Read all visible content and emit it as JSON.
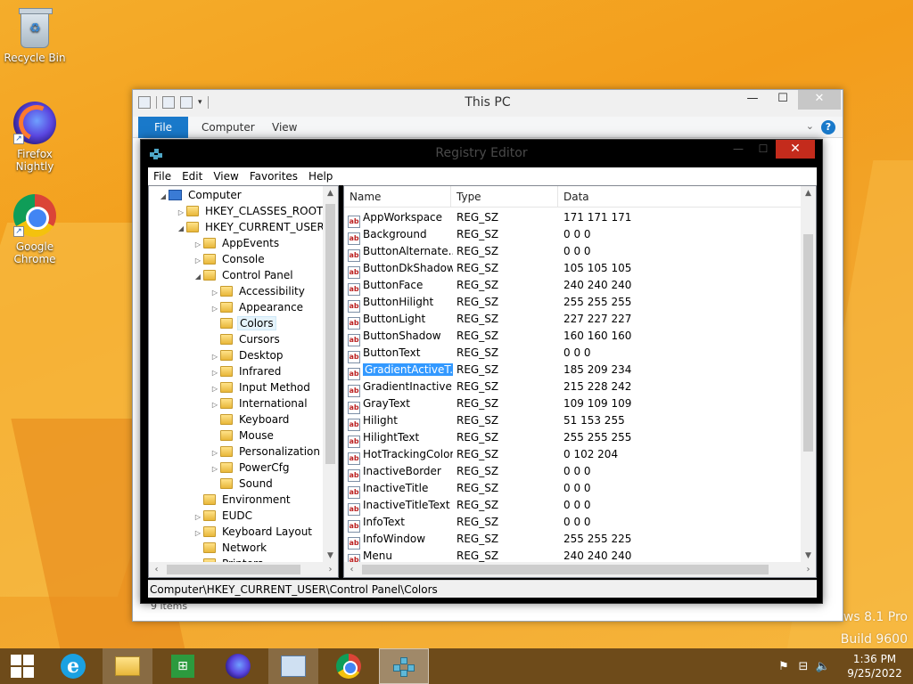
{
  "desktop": {
    "icons": [
      {
        "label": "Recycle Bin"
      },
      {
        "label": "Firefox Nightly"
      },
      {
        "label": "Google Chrome"
      }
    ],
    "watermark_line1": "ows 8.1 Pro",
    "watermark_line2": "Build 9600"
  },
  "explorer": {
    "title": "This PC",
    "tabs": [
      "File",
      "Computer",
      "View"
    ],
    "status": "9 items",
    "help": "?"
  },
  "regedit": {
    "title": "Registry Editor",
    "menu": [
      "File",
      "Edit",
      "View",
      "Favorites",
      "Help"
    ],
    "tree": [
      {
        "label": "Computer",
        "level": 0,
        "exp": "◢",
        "icon": "pc"
      },
      {
        "label": "HKEY_CLASSES_ROOT",
        "level": 1,
        "exp": "▷"
      },
      {
        "label": "HKEY_CURRENT_USER",
        "level": 1,
        "exp": "◢"
      },
      {
        "label": "AppEvents",
        "level": 2,
        "exp": "▷"
      },
      {
        "label": "Console",
        "level": 2,
        "exp": "▷"
      },
      {
        "label": "Control Panel",
        "level": 2,
        "exp": "◢"
      },
      {
        "label": "Accessibility",
        "level": 3,
        "exp": "▷"
      },
      {
        "label": "Appearance",
        "level": 3,
        "exp": "▷"
      },
      {
        "label": "Colors",
        "level": 3,
        "exp": "",
        "selected": true
      },
      {
        "label": "Cursors",
        "level": 3,
        "exp": ""
      },
      {
        "label": "Desktop",
        "level": 3,
        "exp": "▷"
      },
      {
        "label": "Infrared",
        "level": 3,
        "exp": "▷"
      },
      {
        "label": "Input Method",
        "level": 3,
        "exp": "▷"
      },
      {
        "label": "International",
        "level": 3,
        "exp": "▷"
      },
      {
        "label": "Keyboard",
        "level": 3,
        "exp": ""
      },
      {
        "label": "Mouse",
        "level": 3,
        "exp": ""
      },
      {
        "label": "Personalization",
        "level": 3,
        "exp": "▷"
      },
      {
        "label": "PowerCfg",
        "level": 3,
        "exp": "▷"
      },
      {
        "label": "Sound",
        "level": 3,
        "exp": ""
      },
      {
        "label": "Environment",
        "level": 2,
        "exp": ""
      },
      {
        "label": "EUDC",
        "level": 2,
        "exp": "▷"
      },
      {
        "label": "Keyboard Layout",
        "level": 2,
        "exp": "▷"
      },
      {
        "label": "Network",
        "level": 2,
        "exp": ""
      },
      {
        "label": "Printers",
        "level": 2,
        "exp": "▷"
      }
    ],
    "columns": {
      "name": "Name",
      "type": "Type",
      "data": "Data"
    },
    "values": [
      {
        "name": "AppWorkspace",
        "type": "REG_SZ",
        "data": "171 171 171"
      },
      {
        "name": "Background",
        "type": "REG_SZ",
        "data": "0 0 0"
      },
      {
        "name": "ButtonAlternate...",
        "type": "REG_SZ",
        "data": "0 0 0"
      },
      {
        "name": "ButtonDkShadow",
        "type": "REG_SZ",
        "data": "105 105 105"
      },
      {
        "name": "ButtonFace",
        "type": "REG_SZ",
        "data": "240 240 240"
      },
      {
        "name": "ButtonHilight",
        "type": "REG_SZ",
        "data": "255 255 255"
      },
      {
        "name": "ButtonLight",
        "type": "REG_SZ",
        "data": "227 227 227"
      },
      {
        "name": "ButtonShadow",
        "type": "REG_SZ",
        "data": "160 160 160"
      },
      {
        "name": "ButtonText",
        "type": "REG_SZ",
        "data": "0 0 0"
      },
      {
        "name": "GradientActiveT...",
        "type": "REG_SZ",
        "data": "185 209 234",
        "selected": true
      },
      {
        "name": "GradientInactive...",
        "type": "REG_SZ",
        "data": "215 228 242"
      },
      {
        "name": "GrayText",
        "type": "REG_SZ",
        "data": "109 109 109"
      },
      {
        "name": "Hilight",
        "type": "REG_SZ",
        "data": "51 153 255"
      },
      {
        "name": "HilightText",
        "type": "REG_SZ",
        "data": "255 255 255"
      },
      {
        "name": "HotTrackingColor",
        "type": "REG_SZ",
        "data": "0 102 204"
      },
      {
        "name": "InactiveBorder",
        "type": "REG_SZ",
        "data": "0 0 0"
      },
      {
        "name": "InactiveTitle",
        "type": "REG_SZ",
        "data": "0 0 0"
      },
      {
        "name": "InactiveTitleText",
        "type": "REG_SZ",
        "data": "0 0 0"
      },
      {
        "name": "InfoText",
        "type": "REG_SZ",
        "data": "0 0 0"
      },
      {
        "name": "InfoWindow",
        "type": "REG_SZ",
        "data": "255 255 225"
      },
      {
        "name": "Menu",
        "type": "REG_SZ",
        "data": "240 240 240"
      }
    ],
    "status_path": "Computer\\HKEY_CURRENT_USER\\Control Panel\\Colors"
  },
  "taskbar": {
    "apps": [
      "start-icon",
      "internet-explorer-icon",
      "file-explorer-icon",
      "store-icon",
      "firefox-nightly-icon",
      "control-panel-icon",
      "chrome-icon",
      "registry-editor-icon"
    ],
    "time": "1:36 PM",
    "date": "9/25/2022"
  },
  "colors": {
    "selection": "#3399ff",
    "file_tab": "#1979ca",
    "close_red": "#c42b1c",
    "taskbar": "#6e4b1a"
  }
}
